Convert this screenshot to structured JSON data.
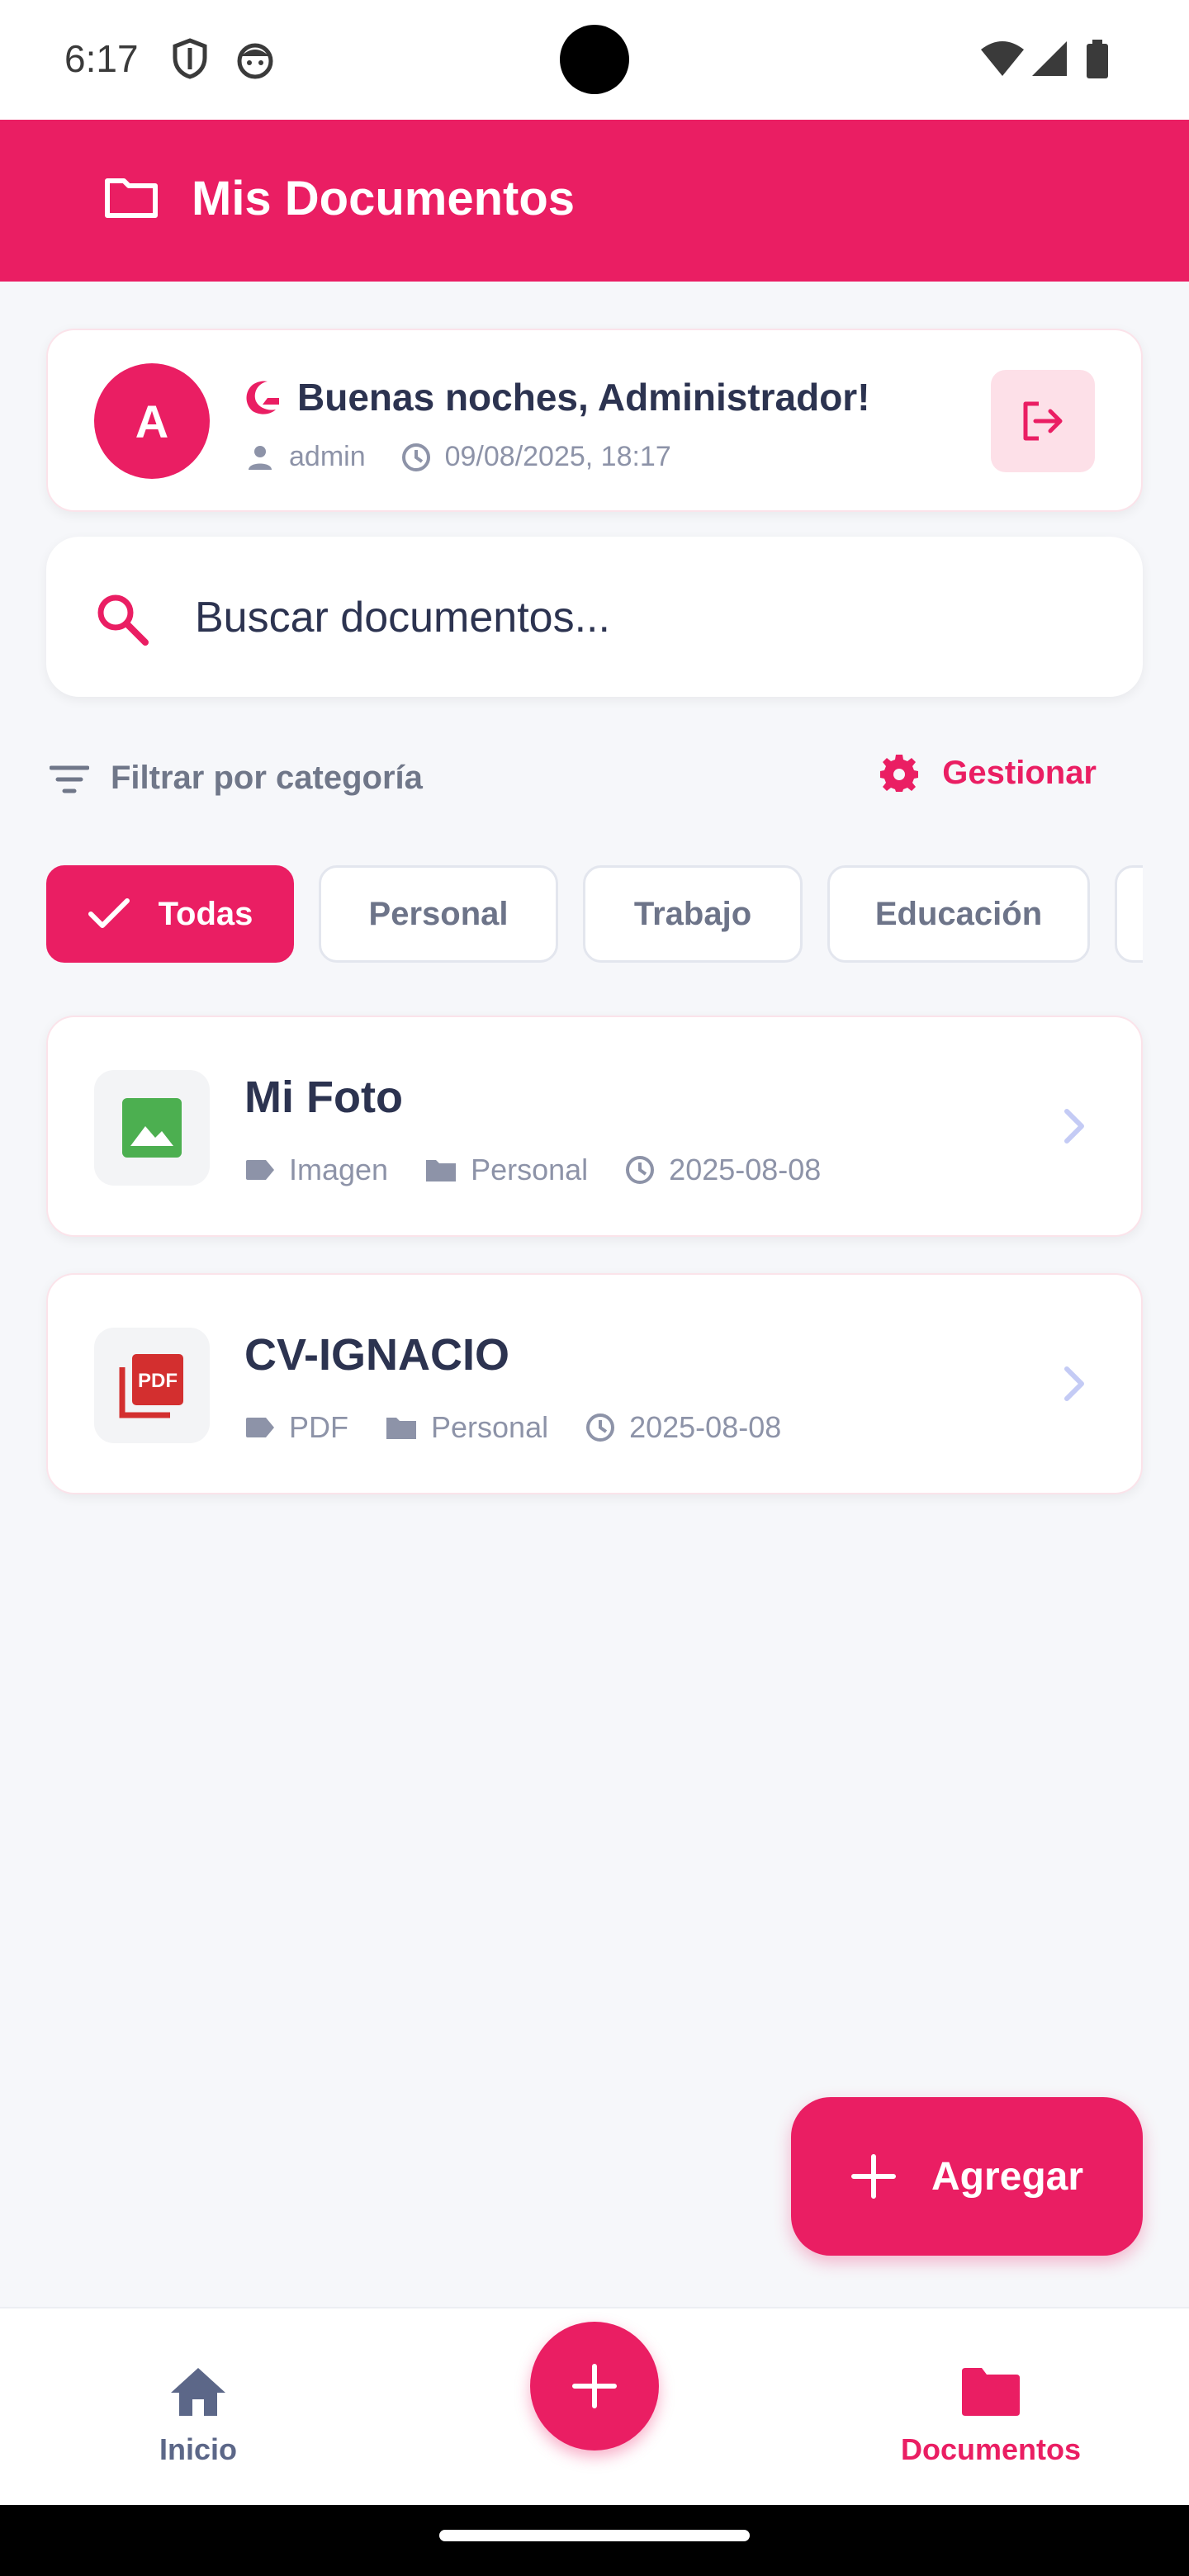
{
  "status_bar": {
    "time": "6:17"
  },
  "app_bar": {
    "title": "Mis Documentos"
  },
  "greeting": {
    "avatar_letter": "A",
    "title": "Buenas noches, Administrador!",
    "user": "admin",
    "datetime": "09/08/2025, 18:17"
  },
  "search": {
    "placeholder": "Buscar documentos..."
  },
  "filter": {
    "label": "Filtrar por categoría",
    "manage_label": "Gestionar"
  },
  "categories": [
    {
      "label": "Todas",
      "active": true
    },
    {
      "label": "Personal",
      "active": false
    },
    {
      "label": "Trabajo",
      "active": false
    },
    {
      "label": "Educación",
      "active": false
    }
  ],
  "documents": [
    {
      "title": "Mi Foto",
      "type": "Imagen",
      "category": "Personal",
      "date": "2025-08-08",
      "icon": "image-icon"
    },
    {
      "title": "CV-IGNACIO",
      "type": "PDF",
      "category": "Personal",
      "date": "2025-08-08",
      "icon": "pdf-icon"
    }
  ],
  "fab": {
    "label": "Agregar"
  },
  "bottom_nav": {
    "home_label": "Inicio",
    "docs_label": "Documentos"
  },
  "colors": {
    "accent": "#ea1e63",
    "background": "#f6f7fa",
    "text": "#2c3350",
    "muted": "#8d93a8"
  }
}
